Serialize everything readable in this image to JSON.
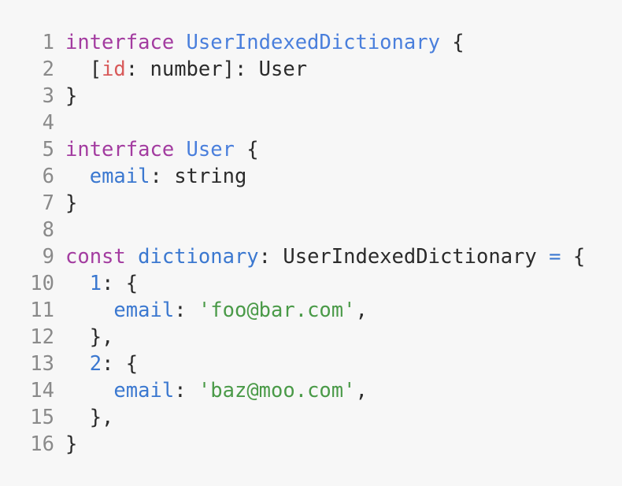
{
  "editor": {
    "lines": [
      {
        "number": "1",
        "tokens": [
          {
            "text": "interface",
            "role": "keyword"
          },
          {
            "text": " ",
            "role": "plain"
          },
          {
            "text": "UserIndexedDictionary",
            "role": "type-name"
          },
          {
            "text": " {",
            "role": "plain"
          }
        ]
      },
      {
        "number": "2",
        "tokens": [
          {
            "text": "  [",
            "role": "plain"
          },
          {
            "text": "id",
            "role": "parameter"
          },
          {
            "text": ": number]: User",
            "role": "plain"
          }
        ]
      },
      {
        "number": "3",
        "tokens": [
          {
            "text": "}",
            "role": "plain"
          }
        ]
      },
      {
        "number": "4",
        "tokens": []
      },
      {
        "number": "5",
        "tokens": [
          {
            "text": "interface",
            "role": "keyword"
          },
          {
            "text": " ",
            "role": "plain"
          },
          {
            "text": "User",
            "role": "type-name"
          },
          {
            "text": " {",
            "role": "plain"
          }
        ]
      },
      {
        "number": "6",
        "tokens": [
          {
            "text": "  ",
            "role": "plain"
          },
          {
            "text": "email",
            "role": "property"
          },
          {
            "text": ": string",
            "role": "plain"
          }
        ]
      },
      {
        "number": "7",
        "tokens": [
          {
            "text": "}",
            "role": "plain"
          }
        ]
      },
      {
        "number": "8",
        "tokens": []
      },
      {
        "number": "9",
        "tokens": [
          {
            "text": "const",
            "role": "keyword"
          },
          {
            "text": " ",
            "role": "plain"
          },
          {
            "text": "dictionary",
            "role": "variable"
          },
          {
            "text": ": UserIndexedDictionary ",
            "role": "plain"
          },
          {
            "text": "=",
            "role": "operator"
          },
          {
            "text": " {",
            "role": "plain"
          }
        ]
      },
      {
        "number": "10",
        "tokens": [
          {
            "text": "  ",
            "role": "plain"
          },
          {
            "text": "1",
            "role": "number"
          },
          {
            "text": ": {",
            "role": "plain"
          }
        ]
      },
      {
        "number": "11",
        "tokens": [
          {
            "text": "    ",
            "role": "plain"
          },
          {
            "text": "email",
            "role": "property"
          },
          {
            "text": ": ",
            "role": "plain"
          },
          {
            "text": "'foo@bar.com'",
            "role": "string"
          },
          {
            "text": ",",
            "role": "plain"
          }
        ]
      },
      {
        "number": "12",
        "tokens": [
          {
            "text": "  },",
            "role": "plain"
          }
        ]
      },
      {
        "number": "13",
        "tokens": [
          {
            "text": "  ",
            "role": "plain"
          },
          {
            "text": "2",
            "role": "number"
          },
          {
            "text": ": {",
            "role": "plain"
          }
        ]
      },
      {
        "number": "14",
        "tokens": [
          {
            "text": "    ",
            "role": "plain"
          },
          {
            "text": "email",
            "role": "property"
          },
          {
            "text": ": ",
            "role": "plain"
          },
          {
            "text": "'baz@moo.com'",
            "role": "string"
          },
          {
            "text": ",",
            "role": "plain"
          }
        ]
      },
      {
        "number": "15",
        "tokens": [
          {
            "text": "  },",
            "role": "plain"
          }
        ]
      },
      {
        "number": "16",
        "tokens": [
          {
            "text": "}",
            "role": "plain"
          }
        ]
      }
    ]
  },
  "theme": {
    "background": "#f7f7f7",
    "plain": "#2b2b2b",
    "gutter": "#8a8a8a",
    "keyword": "#a33ca0",
    "type-name": "#4a7fdc",
    "parameter": "#d85a5a",
    "property": "#3b78d0",
    "variable": "#3b78d0",
    "number": "#3b78d0",
    "operator": "#3b78d0",
    "string": "#4a9a48"
  }
}
